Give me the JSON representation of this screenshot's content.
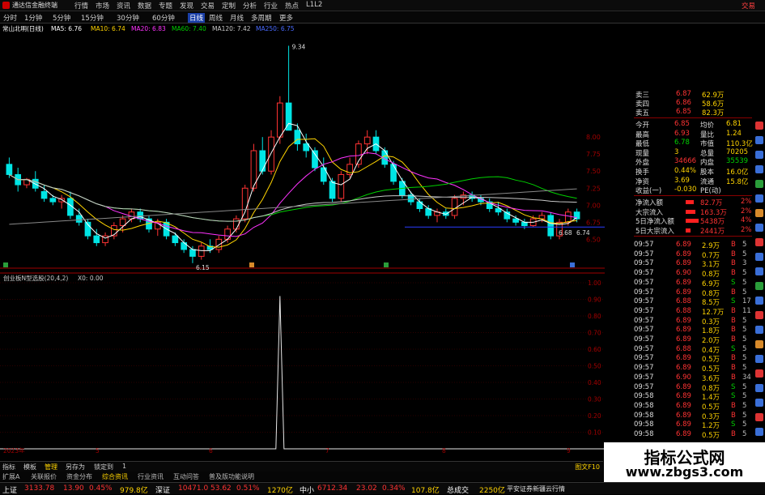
{
  "window": {
    "app_name": "通达信金融终端",
    "trade_label": "交易",
    "menu": [
      "行情",
      "市场",
      "资讯",
      "数据",
      "专题",
      "发现",
      "交易",
      "定制",
      "分析",
      "行业",
      "热点",
      "L1L2"
    ]
  },
  "periods": [
    "分时",
    "1分钟",
    "5分钟",
    "15分钟",
    "30分钟",
    "60分钟",
    "日线",
    "周线",
    "月线",
    "多周期",
    "更多"
  ],
  "active_period": "日线",
  "stock_header": {
    "name": "常山北明(日线)",
    "ma5": "MA5: 6.76",
    "ma10": "MA10: 6.74",
    "ma20": "MA20: 6.83",
    "ma60": "MA60: 7.40",
    "ma120": "MA120: 7.42",
    "ma250": "MA250: 6.75"
  },
  "price_axis": {
    "ticks": [
      "8.00",
      "7.75",
      "7.50",
      "7.25",
      "7.00",
      "6.75",
      "6.50"
    ],
    "high_label": "9.34",
    "low_label": "6.15",
    "last_label": "6.68",
    "last_right": "6.74"
  },
  "indicator_header": {
    "name": "创业板N型选股(20,4,2)",
    "value": "X0: 0.00"
  },
  "indicator_axis": [
    "1.00",
    "0.90",
    "0.80",
    "0.70",
    "0.60",
    "0.50",
    "0.40",
    "0.30",
    "0.20",
    "0.10"
  ],
  "date_axis": [
    "2023年",
    "5",
    "6",
    "7",
    "8",
    "9"
  ],
  "candles": [
    {
      "o": 7.6,
      "h": 7.7,
      "l": 7.4,
      "c": 7.45
    },
    {
      "o": 7.45,
      "h": 7.55,
      "l": 7.2,
      "c": 7.3
    },
    {
      "o": 7.3,
      "h": 7.4,
      "l": 7.25,
      "c": 7.38
    },
    {
      "o": 7.38,
      "h": 7.5,
      "l": 7.2,
      "c": 7.25
    },
    {
      "o": 7.2,
      "h": 7.3,
      "l": 7.05,
      "c": 7.1
    },
    {
      "o": 7.1,
      "h": 7.15,
      "l": 7.0,
      "c": 7.05
    },
    {
      "o": 7.05,
      "h": 7.15,
      "l": 6.95,
      "c": 7.1
    },
    {
      "o": 7.1,
      "h": 7.2,
      "l": 6.8,
      "c": 6.85
    },
    {
      "o": 6.85,
      "h": 6.95,
      "l": 6.7,
      "c": 6.75
    },
    {
      "o": 6.75,
      "h": 6.8,
      "l": 6.5,
      "c": 6.55
    },
    {
      "o": 6.55,
      "h": 6.65,
      "l": 6.4,
      "c": 6.45
    },
    {
      "o": 6.45,
      "h": 6.6,
      "l": 6.4,
      "c": 6.55
    },
    {
      "o": 6.55,
      "h": 6.75,
      "l": 6.5,
      "c": 6.7
    },
    {
      "o": 6.7,
      "h": 6.85,
      "l": 6.6,
      "c": 6.8
    },
    {
      "o": 6.8,
      "h": 6.95,
      "l": 6.75,
      "c": 6.9
    },
    {
      "o": 6.9,
      "h": 6.95,
      "l": 6.75,
      "c": 6.8
    },
    {
      "o": 6.8,
      "h": 6.85,
      "l": 6.6,
      "c": 6.65
    },
    {
      "o": 6.65,
      "h": 6.8,
      "l": 6.55,
      "c": 6.75
    },
    {
      "o": 6.75,
      "h": 6.8,
      "l": 6.5,
      "c": 6.55
    },
    {
      "o": 6.55,
      "h": 6.6,
      "l": 6.4,
      "c": 6.45
    },
    {
      "o": 6.45,
      "h": 6.5,
      "l": 6.3,
      "c": 6.35
    },
    {
      "o": 6.35,
      "h": 6.4,
      "l": 6.15,
      "c": 6.25
    },
    {
      "o": 6.25,
      "h": 6.45,
      "l": 6.2,
      "c": 6.4
    },
    {
      "o": 6.4,
      "h": 6.5,
      "l": 6.3,
      "c": 6.35
    },
    {
      "o": 6.35,
      "h": 6.55,
      "l": 6.3,
      "c": 6.5
    },
    {
      "o": 6.5,
      "h": 6.7,
      "l": 6.45,
      "c": 6.65
    },
    {
      "o": 6.65,
      "h": 6.85,
      "l": 6.6,
      "c": 6.8
    },
    {
      "o": 6.8,
      "h": 7.3,
      "l": 6.75,
      "c": 7.25
    },
    {
      "o": 7.25,
      "h": 7.9,
      "l": 7.2,
      "c": 7.8
    },
    {
      "o": 7.8,
      "h": 8.0,
      "l": 7.45,
      "c": 7.5
    },
    {
      "o": 7.5,
      "h": 8.1,
      "l": 7.45,
      "c": 8.0
    },
    {
      "o": 8.0,
      "h": 8.6,
      "l": 7.9,
      "c": 8.5
    },
    {
      "o": 8.5,
      "h": 9.34,
      "l": 8.3,
      "c": 8.1
    },
    {
      "o": 8.1,
      "h": 8.2,
      "l": 7.8,
      "c": 7.9
    },
    {
      "o": 7.9,
      "h": 8.05,
      "l": 7.7,
      "c": 7.8
    },
    {
      "o": 7.8,
      "h": 7.85,
      "l": 7.5,
      "c": 7.55
    },
    {
      "o": 7.55,
      "h": 7.7,
      "l": 7.3,
      "c": 7.35
    },
    {
      "o": 7.35,
      "h": 7.4,
      "l": 7.05,
      "c": 7.1
    },
    {
      "o": 7.1,
      "h": 7.5,
      "l": 7.05,
      "c": 7.45
    },
    {
      "o": 7.45,
      "h": 7.7,
      "l": 7.4,
      "c": 7.6
    },
    {
      "o": 7.6,
      "h": 7.95,
      "l": 7.55,
      "c": 7.9
    },
    {
      "o": 7.9,
      "h": 8.1,
      "l": 7.75,
      "c": 8.0
    },
    {
      "o": 8.0,
      "h": 8.1,
      "l": 7.75,
      "c": 7.8
    },
    {
      "o": 7.8,
      "h": 7.85,
      "l": 7.55,
      "c": 7.6
    },
    {
      "o": 7.6,
      "h": 7.65,
      "l": 7.3,
      "c": 7.35
    },
    {
      "o": 7.35,
      "h": 7.4,
      "l": 7.1,
      "c": 7.15
    },
    {
      "o": 7.15,
      "h": 7.2,
      "l": 7.0,
      "c": 7.05
    },
    {
      "o": 7.05,
      "h": 7.1,
      "l": 6.9,
      "c": 6.95
    },
    {
      "o": 6.95,
      "h": 7.0,
      "l": 6.8,
      "c": 6.85
    },
    {
      "o": 6.85,
      "h": 6.95,
      "l": 6.75,
      "c": 6.9
    },
    {
      "o": 6.9,
      "h": 6.95,
      "l": 6.8,
      "c": 6.85
    },
    {
      "o": 6.85,
      "h": 7.15,
      "l": 6.8,
      "c": 7.1
    },
    {
      "o": 7.1,
      "h": 7.2,
      "l": 7.0,
      "c": 7.15
    },
    {
      "o": 7.15,
      "h": 7.2,
      "l": 7.05,
      "c": 7.1
    },
    {
      "o": 7.1,
      "h": 7.15,
      "l": 7.0,
      "c": 7.05
    },
    {
      "o": 7.05,
      "h": 7.1,
      "l": 6.9,
      "c": 6.95
    },
    {
      "o": 6.95,
      "h": 7.05,
      "l": 6.85,
      "c": 6.9
    },
    {
      "o": 6.9,
      "h": 6.95,
      "l": 6.75,
      "c": 6.8
    },
    {
      "o": 6.8,
      "h": 6.85,
      "l": 6.7,
      "c": 6.75
    },
    {
      "o": 6.75,
      "h": 6.8,
      "l": 6.65,
      "c": 6.7
    },
    {
      "o": 6.7,
      "h": 6.85,
      "l": 6.68,
      "c": 6.8
    },
    {
      "o": 6.8,
      "h": 6.9,
      "l": 6.75,
      "c": 6.85
    },
    {
      "o": 6.85,
      "h": 6.9,
      "l": 6.5,
      "c": 6.55
    },
    {
      "o": 6.55,
      "h": 6.8,
      "l": 6.5,
      "c": 6.75
    },
    {
      "o": 6.75,
      "h": 6.95,
      "l": 6.7,
      "c": 6.9
    },
    {
      "o": 6.9,
      "h": 6.95,
      "l": 6.75,
      "c": 6.8
    }
  ],
  "colors": {
    "up": "#ff3333",
    "down": "#00e5e5",
    "ma5": "#ffffff",
    "ma10": "#ffd400",
    "ma20": "#ff33ff",
    "ma60": "#00d000",
    "ma120": "#c8c8c8",
    "grid": "#5a0000",
    "axis": "#a00000"
  },
  "quote": {
    "ask": [
      {
        "label": "卖三",
        "price": "6.87",
        "vol": "62.9万"
      },
      {
        "label": "卖四",
        "price": "6.86",
        "vol": "58.6万"
      },
      {
        "label": "卖五",
        "price": "6.85",
        "vol": "82.3万"
      }
    ],
    "stats": [
      {
        "l1": "今开",
        "v1": "6.85",
        "l2": "均价",
        "v2": "6.81"
      },
      {
        "l1": "最高",
        "v1": "6.93",
        "l2": "量比",
        "v2": "1.24"
      },
      {
        "l1": "最低",
        "v1": "6.78",
        "l2": "市值",
        "v2": "110.3亿"
      },
      {
        "l1": "现量",
        "v1": "3",
        "l2": "总量",
        "v2": "70205"
      },
      {
        "l1": "外盘",
        "v1": "34666",
        "l2": "内盘",
        "v2": "35539"
      },
      {
        "l1": "换手",
        "v1": "0.44%",
        "l2": "股本",
        "v2": "16.0亿"
      },
      {
        "l1": "净资",
        "v1": "3.69",
        "l2": "流通",
        "v2": "15.8亿"
      },
      {
        "l1": "收益(一)",
        "v1": "-0.030",
        "l2": "PE(动)",
        "v2": ""
      }
    ],
    "flows": [
      {
        "label": "净流入额",
        "value": "82.7万",
        "pct": "2%"
      },
      {
        "label": "大宗流入",
        "value": "163.3万",
        "pct": "2%"
      },
      {
        "label": "5日净流入额",
        "value": "5438万",
        "pct": "4%"
      },
      {
        "label": "5日大宗流入",
        "value": "2441万",
        "pct": "2%"
      }
    ]
  },
  "ticks": [
    {
      "t": "09:57",
      "p": "6.89",
      "v": "2.9万",
      "s": "B",
      "n": "5"
    },
    {
      "t": "09:57",
      "p": "6.89",
      "v": "0.7万",
      "s": "B",
      "n": "5"
    },
    {
      "t": "09:57",
      "p": "6.89",
      "v": "3.1万",
      "s": "B",
      "n": "3"
    },
    {
      "t": "09:57",
      "p": "6.90",
      "v": "0.8万",
      "s": "B",
      "n": "5"
    },
    {
      "t": "09:57",
      "p": "6.89",
      "v": "6.9万",
      "s": "S",
      "n": "5"
    },
    {
      "t": "09:57",
      "p": "6.89",
      "v": "0.8万",
      "s": "B",
      "n": "5"
    },
    {
      "t": "09:57",
      "p": "6.88",
      "v": "8.5万",
      "s": "S",
      "n": "17"
    },
    {
      "t": "09:57",
      "p": "6.88",
      "v": "12.7万",
      "s": "B",
      "n": "11"
    },
    {
      "t": "09:57",
      "p": "6.89",
      "v": "0.3万",
      "s": "B",
      "n": "5"
    },
    {
      "t": "09:57",
      "p": "6.89",
      "v": "1.8万",
      "s": "B",
      "n": "5"
    },
    {
      "t": "09:57",
      "p": "6.89",
      "v": "2.0万",
      "s": "B",
      "n": "5"
    },
    {
      "t": "09:57",
      "p": "6.88",
      "v": "0.4万",
      "s": "S",
      "n": "5"
    },
    {
      "t": "09:57",
      "p": "6.89",
      "v": "0.5万",
      "s": "B",
      "n": "5"
    },
    {
      "t": "09:57",
      "p": "6.89",
      "v": "0.5万",
      "s": "B",
      "n": "5"
    },
    {
      "t": "09:57",
      "p": "6.90",
      "v": "3.6万",
      "s": "B",
      "n": "34"
    },
    {
      "t": "09:57",
      "p": "6.89",
      "v": "0.8万",
      "s": "S",
      "n": "5"
    },
    {
      "t": "09:58",
      "p": "6.89",
      "v": "1.4万",
      "s": "S",
      "n": "5"
    },
    {
      "t": "09:58",
      "p": "6.89",
      "v": "0.5万",
      "s": "B",
      "n": "5"
    },
    {
      "t": "09:58",
      "p": "6.89",
      "v": "0.3万",
      "s": "B",
      "n": "5"
    },
    {
      "t": "09:58",
      "p": "6.89",
      "v": "1.2万",
      "s": "S",
      "n": "5"
    },
    {
      "t": "09:58",
      "p": "6.89",
      "v": "0.5万",
      "s": "B",
      "n": "5"
    }
  ],
  "tabs": [
    "指标",
    "模板",
    "管理",
    "另存为",
    "锁定到",
    "1"
  ],
  "indicator_tabs": [
    "扩展A",
    "关联报价",
    "资金分布",
    "综合资讯",
    "行业资讯",
    "互动问答",
    "普及版功能说明"
  ],
  "side_label": "图文F10",
  "ticker": {
    "sh_label": "上证",
    "sh_value": "3133.78",
    "sh_change": "13.90",
    "sh_pct": "0.45%",
    "sh_amount": "979.8亿",
    "sz_label": "深证",
    "sz_value": "10471.0",
    "sz_change": "53.62",
    "sz_pct": "0.51%",
    "sz_amount": "1270亿",
    "zx_label": "中小",
    "zx_value": "6712.34",
    "zx_change": "23.02",
    "zx_pct": "0.34%",
    "zx_amount": "107.8亿",
    "trade_label": "总成交",
    "trade_value": "2250亿",
    "news": "平安证券新疆云行情"
  },
  "watermark": {
    "title": "指标公式网",
    "url": "www.zbgs3.com"
  }
}
